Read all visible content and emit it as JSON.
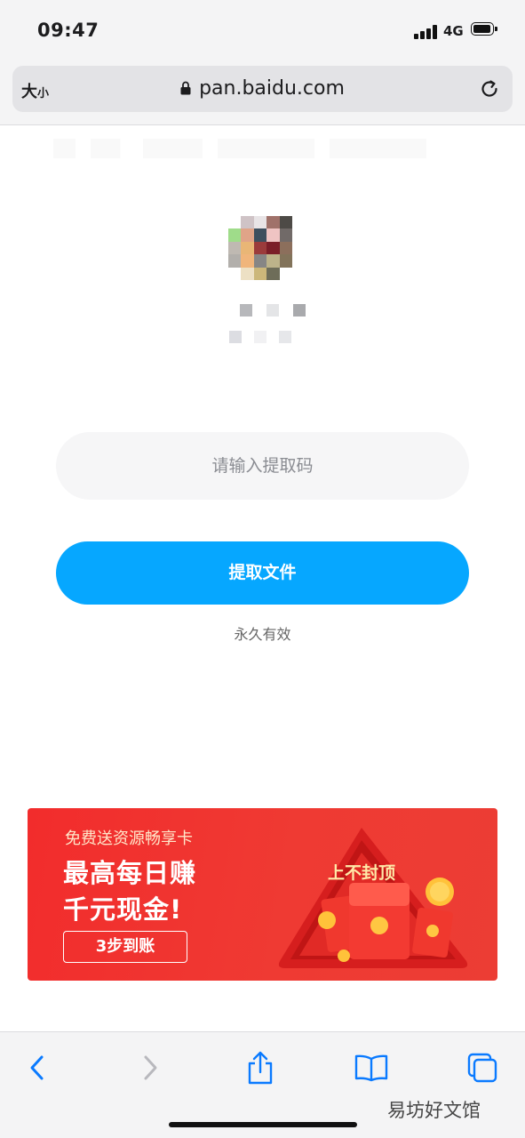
{
  "status_bar": {
    "time": "09:47",
    "network": "4G"
  },
  "browser": {
    "text_size_big": "大",
    "text_size_small": "小",
    "url": "pan.baidu.com",
    "icons": {
      "lock": "lock-icon",
      "reload": "reload-icon"
    }
  },
  "share": {
    "code_placeholder": "请输入提取码",
    "extract_button": "提取文件",
    "validity": "永久有效"
  },
  "banner": {
    "subtitle": "免费送资源畅享卡",
    "headline_1": "最高每日赚",
    "headline_2": "千元现金!",
    "cta": "3步到账",
    "tag": "上不封顶",
    "colors": {
      "background": "#f22c2c",
      "accent": "#ffcf3a"
    }
  },
  "toolbar": {
    "icons": [
      "back-icon",
      "forward-icon",
      "share-icon",
      "bookmarks-icon",
      "tabs-icon"
    ]
  },
  "watermark": "易坊好文馆",
  "colors": {
    "primary": "#06a7ff",
    "input_bg": "#f6f6f7"
  }
}
